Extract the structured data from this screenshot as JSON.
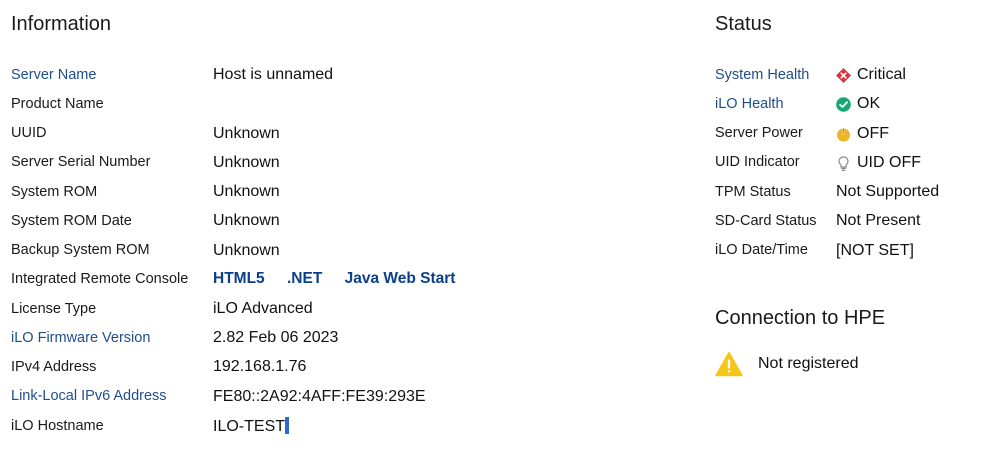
{
  "information": {
    "title": "Information",
    "rows": [
      {
        "label": "Server Name",
        "value": "Host is unnamed",
        "link": true
      },
      {
        "label": "Product Name",
        "value": "",
        "link": false
      },
      {
        "label": "UUID",
        "value": "Unknown",
        "link": false
      },
      {
        "label": "Server Serial Number",
        "value": "Unknown",
        "link": false
      },
      {
        "label": "System ROM",
        "value": "Unknown",
        "link": false
      },
      {
        "label": "System ROM Date",
        "value": "Unknown",
        "link": false
      },
      {
        "label": "Backup System ROM",
        "value": "Unknown",
        "link": false
      },
      {
        "label": "Integrated Remote Console",
        "value": "",
        "link": false
      },
      {
        "label": "License Type",
        "value": "iLO Advanced",
        "link": false
      },
      {
        "label": "iLO Firmware Version",
        "value": "2.82 Feb 06 2023",
        "link": true
      },
      {
        "label": "IPv4 Address",
        "value": "192.168.1.76",
        "link": false
      },
      {
        "label": "Link-Local IPv6 Address",
        "value": "FE80::2A92:4AFF:FE39:293E",
        "link": true
      },
      {
        "label": "iLO Hostname",
        "value": "ILO-TEST",
        "link": false
      }
    ],
    "console_links": [
      "HTML5",
      ".NET",
      "Java Web Start"
    ]
  },
  "status": {
    "title": "Status",
    "rows": [
      {
        "label": "System Health",
        "value": "Critical",
        "link": true,
        "icon": "critical-icon",
        "color": "#d9363e"
      },
      {
        "label": "iLO Health",
        "value": "OK",
        "link": true,
        "icon": "ok-icon",
        "color": "#17a673"
      },
      {
        "label": "Server Power",
        "value": "OFF",
        "link": false,
        "icon": "power-icon",
        "color": "#f0b429"
      },
      {
        "label": "UID Indicator",
        "value": "UID OFF",
        "link": false,
        "icon": "lightbulb-icon",
        "color": "#9a9a9a"
      },
      {
        "label": "TPM Status",
        "value": "Not Supported",
        "link": false,
        "icon": "",
        "color": ""
      },
      {
        "label": "SD-Card Status",
        "value": "Not Present",
        "link": false,
        "icon": "",
        "color": ""
      },
      {
        "label": "iLO Date/Time",
        "value": "[NOT SET]",
        "link": false,
        "icon": "",
        "color": ""
      }
    ]
  },
  "hpe": {
    "title": "Connection to HPE",
    "status": "Not registered",
    "icon": "warning-icon",
    "icon_color": "#f5c518"
  }
}
